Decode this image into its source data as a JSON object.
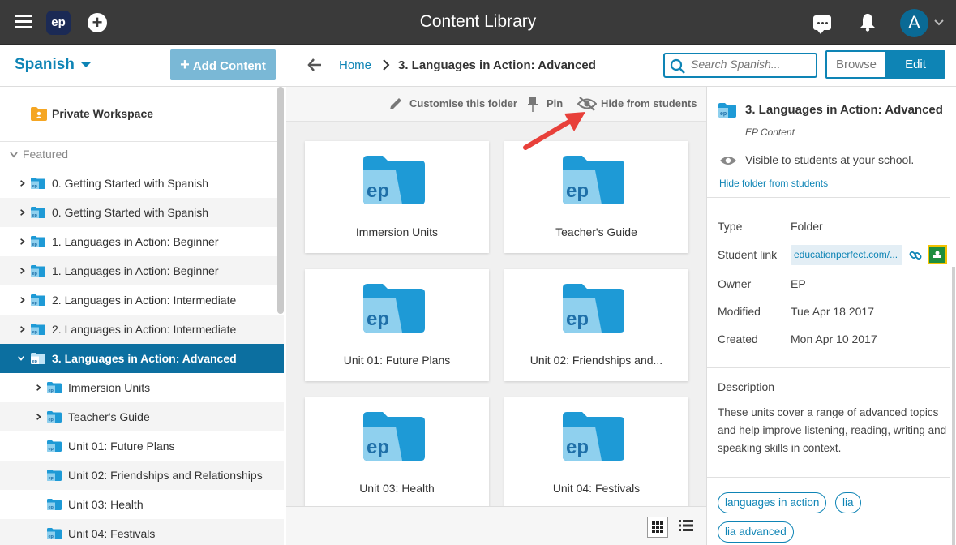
{
  "app": {
    "title": "Content Library",
    "logo_text": "ep",
    "avatar_initial": "A"
  },
  "subheader": {
    "subject": "Spanish",
    "add_content": "Add Content",
    "breadcrumb_home": "Home",
    "breadcrumb_current": "3. Languages in Action: Advanced",
    "search_placeholder": "Search Spanish...",
    "browse": "Browse",
    "edit": "Edit"
  },
  "sidebar": {
    "private_workspace": "Private Workspace",
    "featured": "Featured",
    "items": [
      {
        "label": "0. Getting Started with Spanish"
      },
      {
        "label": "0. Getting Started with Spanish"
      },
      {
        "label": "1. Languages in Action: Beginner"
      },
      {
        "label": "1. Languages in Action: Beginner"
      },
      {
        "label": "2. Languages in Action: Intermediate"
      },
      {
        "label": "2. Languages in Action: Intermediate"
      },
      {
        "label": "3. Languages in Action: Advanced"
      },
      {
        "label": "Immersion Units"
      },
      {
        "label": "Teacher's Guide"
      },
      {
        "label": "Unit 01: Future Plans"
      },
      {
        "label": "Unit 02: Friendships and Relationships"
      },
      {
        "label": "Unit 03: Health"
      },
      {
        "label": "Unit 04: Festivals"
      }
    ]
  },
  "toolbar": {
    "customise": "Customise this folder",
    "pin": "Pin",
    "hide": "Hide from students"
  },
  "cards": [
    {
      "label": "Immersion Units"
    },
    {
      "label": "Teacher's Guide"
    },
    {
      "label": "Unit 01: Future Plans"
    },
    {
      "label": "Unit 02: Friendships and..."
    },
    {
      "label": "Unit 03: Health"
    },
    {
      "label": "Unit 04: Festivals"
    }
  ],
  "details": {
    "title": "3. Languages in Action: Advanced",
    "subtitle": "EP Content",
    "visibility": "Visible to students at your school.",
    "hide_link": "Hide folder from students",
    "type_label": "Type",
    "type_value": "Folder",
    "student_link_label": "Student link",
    "student_link_value": "educationperfect.com/...",
    "owner_label": "Owner",
    "owner_value": "EP",
    "modified_label": "Modified",
    "modified_value": "Tue Apr 18 2017",
    "created_label": "Created",
    "created_value": "Mon Apr 10 2017",
    "description_label": "Description",
    "description": "These units cover a range of advanced topics and help improve listening, reading, writing and speaking skills in context.",
    "tags": [
      "languages in action",
      "lia",
      "lia advanced"
    ]
  },
  "colors": {
    "accent": "#0e84b5",
    "topbar": "#3a3a3a",
    "active_row": "#0c6fa0",
    "folder": "#1e9ad6",
    "annotation_arrow": "#e8403a"
  }
}
